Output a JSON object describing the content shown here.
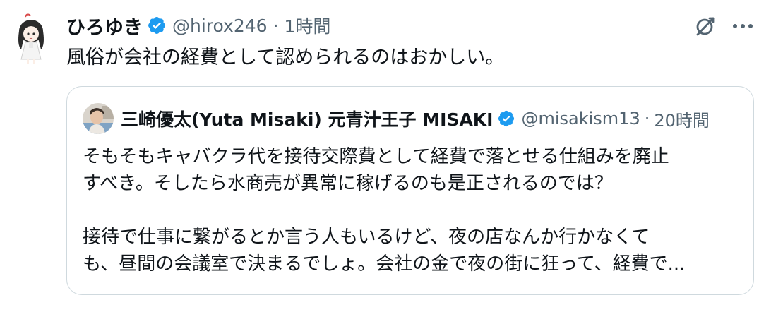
{
  "tweet": {
    "display_name": "ひろゆき",
    "handle": "@hirox246",
    "separator": "·",
    "time": "1時間",
    "text": "風俗が会社の経費として認められるのはおかしい。"
  },
  "quote": {
    "display_name": "三崎優太(Yuta Misaki) 元青汁王子 MISAKI",
    "handle": "@misakism13",
    "separator": "·",
    "time": "20時間",
    "lines": [
      "そもそもキャバクラ代を接待交際費として経費で落とせる仕組みを廃止",
      "すべき。そしたら水商売が異常に稼げるのも是正されるのでは？",
      "",
      "接待で仕事に繋がるとか言う人もいるけど、夜の店なんか行かなくて",
      "も、昼間の会議室で決まるでしょ。会社の金で夜の街に狂って、経費で..."
    ]
  },
  "icons": {
    "verified": "verified-badge-icon",
    "grok": "grok-icon",
    "more": "more-icon"
  },
  "colors": {
    "verified": "#1d9bf0",
    "secondary_text": "#536471",
    "border": "#cfd9de"
  }
}
